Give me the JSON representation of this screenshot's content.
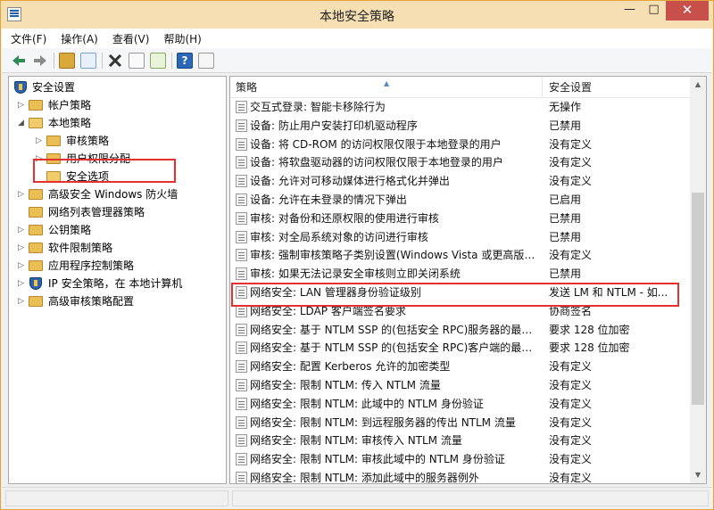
{
  "window": {
    "title": "本地安全策略",
    "min_label": "—",
    "max_label": "□",
    "close_label": "✕"
  },
  "menu": [
    "文件(F)",
    "操作(A)",
    "查看(V)",
    "帮助(H)"
  ],
  "toolbar": {
    "help_label": "?",
    "icons": [
      "back-arrow-icon",
      "forward-arrow-icon",
      "up-folder-icon",
      "show-hide-tree-icon",
      "delete-icon",
      "properties-icon",
      "export-list-icon",
      "help-icon",
      "view-icon"
    ]
  },
  "tree": {
    "root": "安全设置",
    "items": [
      {
        "label": "帐户策略"
      },
      {
        "label": "本地策略"
      },
      {
        "label": "审核策略"
      },
      {
        "label": "用户权限分配"
      },
      {
        "label": "安全选项"
      },
      {
        "label": "高级安全 Windows 防火墙"
      },
      {
        "label": "网络列表管理器策略"
      },
      {
        "label": "公钥策略"
      },
      {
        "label": "软件限制策略"
      },
      {
        "label": "应用程序控制策略"
      },
      {
        "label": "IP 安全策略，在 本地计算机"
      },
      {
        "label": "高级审核策略配置"
      }
    ]
  },
  "list": {
    "col_policy": "策略",
    "col_setting": "安全设置",
    "rows": [
      {
        "name": "交互式登录: 智能卡移除行为",
        "setting": "无操作"
      },
      {
        "name": "设备: 防止用户安装打印机驱动程序",
        "setting": "已禁用"
      },
      {
        "name": "设备: 将 CD-ROM 的访问权限仅限于本地登录的用户",
        "setting": "没有定义"
      },
      {
        "name": "设备: 将软盘驱动器的访问权限仅限于本地登录的用户",
        "setting": "没有定义"
      },
      {
        "name": "设备: 允许对可移动媒体进行格式化并弹出",
        "setting": "没有定义"
      },
      {
        "name": "设备: 允许在未登录的情况下弹出",
        "setting": "已启用"
      },
      {
        "name": "审核: 对备份和还原权限的使用进行审核",
        "setting": "已禁用"
      },
      {
        "name": "审核: 对全局系统对象的访问进行审核",
        "setting": "已禁用"
      },
      {
        "name": "审核: 强制审核策略子类别设置(Windows Vista 或更高版本...",
        "setting": "没有定义"
      },
      {
        "name": "审核: 如果无法记录安全审核则立即关闭系统",
        "setting": "已禁用"
      },
      {
        "name": "网络安全: LAN 管理器身份验证级别",
        "setting": "发送 LM 和 NTLM - 如..."
      },
      {
        "name": "网络安全: LDAP 客户端签名要求",
        "setting": "协商签名"
      },
      {
        "name": "网络安全: 基于 NTLM SSP 的(包括安全 RPC)服务器的最小...",
        "setting": "要求 128 位加密"
      },
      {
        "name": "网络安全: 基于 NTLM SSP 的(包括安全 RPC)客户端的最小...",
        "setting": "要求 128 位加密"
      },
      {
        "name": "网络安全: 配置 Kerberos 允许的加密类型",
        "setting": "没有定义"
      },
      {
        "name": "网络安全: 限制 NTLM: 传入 NTLM 流量",
        "setting": "没有定义"
      },
      {
        "name": "网络安全: 限制 NTLM: 此域中的 NTLM 身份验证",
        "setting": "没有定义"
      },
      {
        "name": "网络安全: 限制 NTLM: 到远程服务器的传出 NTLM 流量",
        "setting": "没有定义"
      },
      {
        "name": "网络安全: 限制 NTLM: 审核传入 NTLM 流量",
        "setting": "没有定义"
      },
      {
        "name": "网络安全: 限制 NTLM: 审核此域中的 NTLM 身份验证",
        "setting": "没有定义"
      },
      {
        "name": "网络安全: 限制 NTLM: 添加此域中的服务器例外",
        "setting": "没有定义"
      }
    ]
  },
  "colors": {
    "titlebar": "#f5dfb3",
    "highlight_border": "#e53030",
    "close_button": "#c7504a"
  }
}
